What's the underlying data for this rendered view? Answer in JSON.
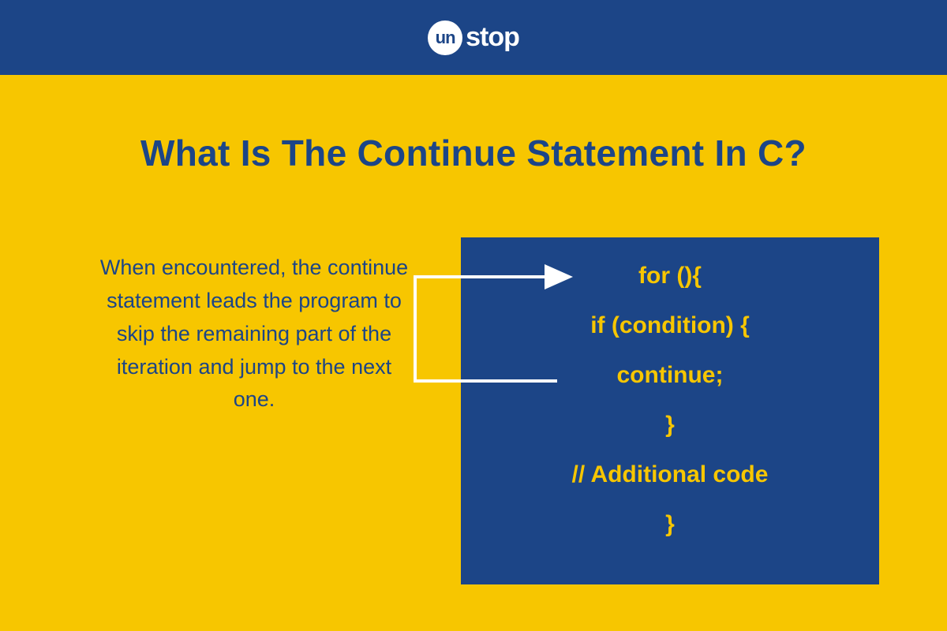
{
  "header": {
    "logo_circle_text": "un",
    "logo_rest_text": "stop"
  },
  "title": "What Is The Continue Statement In C?",
  "description": "When encountered, the continue statement leads the program to skip the remaining part of the iteration and jump to the next one.",
  "code": {
    "line1": "for (){",
    "line2": "if (condition) {",
    "line3": "continue;",
    "line4": "}",
    "line5": "// Additional code",
    "line6": "}"
  },
  "colors": {
    "brand_blue": "#1c4587",
    "brand_yellow": "#f7c600",
    "white": "#ffffff"
  }
}
